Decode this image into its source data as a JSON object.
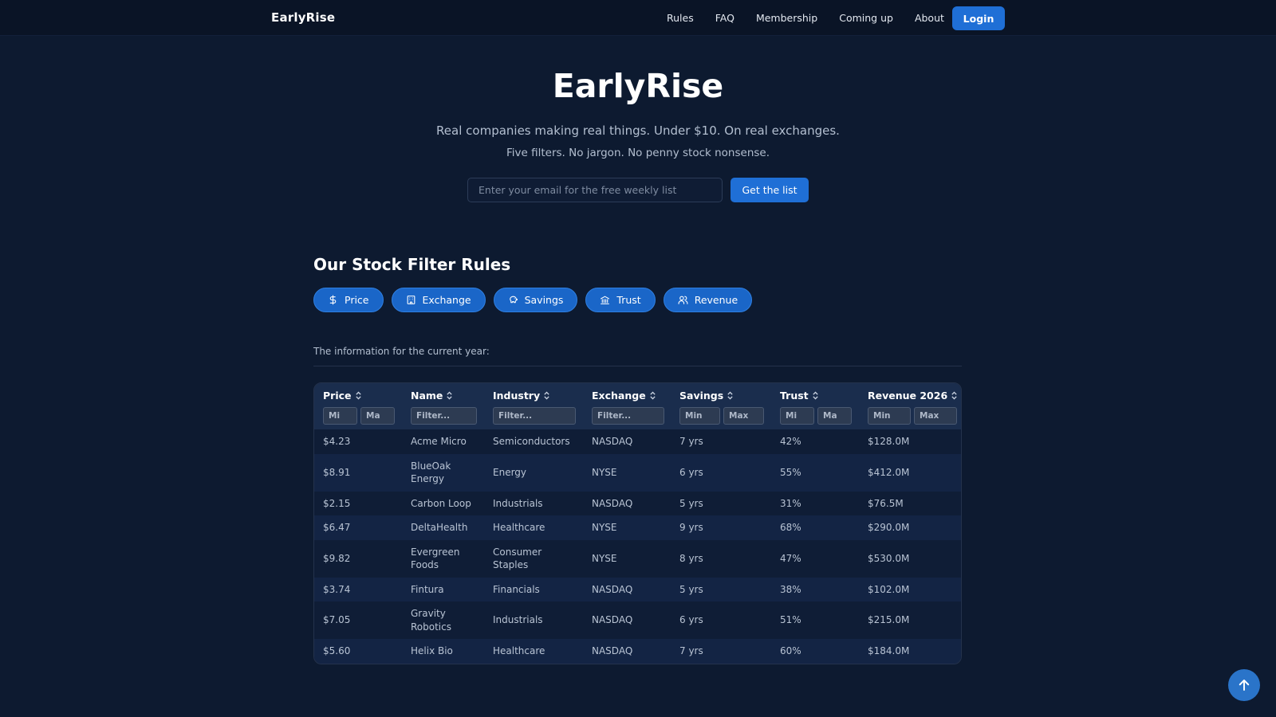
{
  "nav": {
    "brand": "EarlyRise",
    "links": [
      "Rules",
      "FAQ",
      "Membership",
      "Coming up",
      "About"
    ],
    "login_label": "Login"
  },
  "hero": {
    "title": "EarlyRise",
    "subtitle": "Real companies making real things. Under $10. On real exchanges.",
    "tagline": "Five filters. No jargon. No penny stock nonsense.",
    "email_placeholder": "Enter your email for the free weekly list",
    "cta_label": "Get the list"
  },
  "rules": {
    "title": "Our Stock Filter Rules",
    "pills": [
      {
        "label": "Price",
        "icon": "dollar-icon"
      },
      {
        "label": "Exchange",
        "icon": "building-icon"
      },
      {
        "label": "Savings",
        "icon": "piggy-bank-icon"
      },
      {
        "label": "Trust",
        "icon": "bank-icon"
      },
      {
        "label": "Revenue",
        "icon": "users-icon"
      }
    ],
    "info": "The information for the current year:"
  },
  "table": {
    "columns": [
      "Price",
      "Name",
      "Industry",
      "Exchange",
      "Savings",
      "Trust",
      "Revenue 2026"
    ],
    "filter_placeholders": {
      "min_short": "Mi",
      "max_short": "Ma",
      "min": "Min",
      "max": "Max",
      "text": "Filter..."
    },
    "rows": [
      [
        "$4.23",
        "Acme Micro",
        "Semiconductors",
        "NASDAQ",
        "7 yrs",
        "42%",
        "$128.0M"
      ],
      [
        "$8.91",
        "BlueOak Energy",
        "Energy",
        "NYSE",
        "6 yrs",
        "55%",
        "$412.0M"
      ],
      [
        "$2.15",
        "Carbon Loop",
        "Industrials",
        "NASDAQ",
        "5 yrs",
        "31%",
        "$76.5M"
      ],
      [
        "$6.47",
        "DeltaHealth",
        "Healthcare",
        "NYSE",
        "9 yrs",
        "68%",
        "$290.0M"
      ],
      [
        "$9.82",
        "Evergreen Foods",
        "Consumer Staples",
        "NYSE",
        "8 yrs",
        "47%",
        "$530.0M"
      ],
      [
        "$3.74",
        "Fintura",
        "Financials",
        "NASDAQ",
        "5 yrs",
        "38%",
        "$102.0M"
      ],
      [
        "$7.05",
        "Gravity Robotics",
        "Industrials",
        "NASDAQ",
        "6 yrs",
        "51%",
        "$215.0M"
      ],
      [
        "$5.60",
        "Helix Bio",
        "Healthcare",
        "NASDAQ",
        "7 yrs",
        "60%",
        "$184.0M"
      ]
    ]
  },
  "colors": {
    "background": "#0d1a30",
    "nav_background": "#0a1426",
    "accent": "#1f6fd6",
    "table_header": "#1a2d4d"
  }
}
